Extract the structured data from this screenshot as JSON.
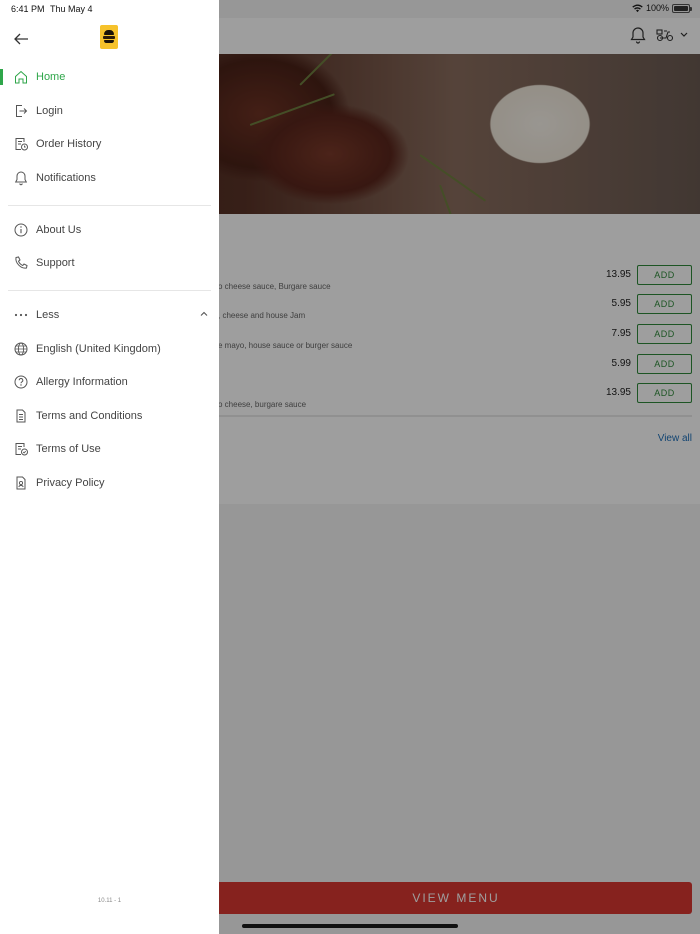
{
  "status_bar": {
    "time": "6:41 PM",
    "date": "Thu May 4",
    "battery": "100%"
  },
  "drawer": {
    "nav": [
      {
        "label": "Home",
        "icon": "home-icon",
        "active": true
      },
      {
        "label": "Login",
        "icon": "login-icon"
      },
      {
        "label": "Order History",
        "icon": "order-history-icon"
      },
      {
        "label": "Notifications",
        "icon": "bell-icon"
      }
    ],
    "info": [
      {
        "label": "About Us",
        "icon": "info-icon"
      },
      {
        "label": "Support",
        "icon": "phone-icon"
      }
    ],
    "less_label": "Less",
    "more_items": [
      {
        "label": "English (United Kingdom)",
        "icon": "globe-icon"
      },
      {
        "label": "Allergy Information",
        "icon": "question-icon"
      },
      {
        "label": "Terms and Conditions",
        "icon": "document-icon"
      },
      {
        "label": "Terms of Use",
        "icon": "document-check-icon"
      },
      {
        "label": "Privacy Policy",
        "icon": "privacy-icon"
      }
    ],
    "version": "10.11 - 1",
    "accent_color": "#2fa64a"
  },
  "menu": {
    "items": [
      {
        "desc": "o cheese sauce, Burgare sauce",
        "price": "13.95",
        "add": "ADD"
      },
      {
        "desc": ", cheese and house Jam",
        "price": "5.95",
        "add": "ADD"
      },
      {
        "desc": "e mayo, house sauce or burger sauce",
        "price": "7.95",
        "add": "ADD"
      },
      {
        "desc": "",
        "price": "5.99",
        "add": "ADD"
      },
      {
        "desc": "o cheese, burgare sauce",
        "price": "13.95",
        "add": "ADD"
      }
    ],
    "view_all": "View all",
    "view_menu": "VIEW MENU",
    "add_color": "#2f8a3a",
    "view_menu_color": "#d93731"
  }
}
